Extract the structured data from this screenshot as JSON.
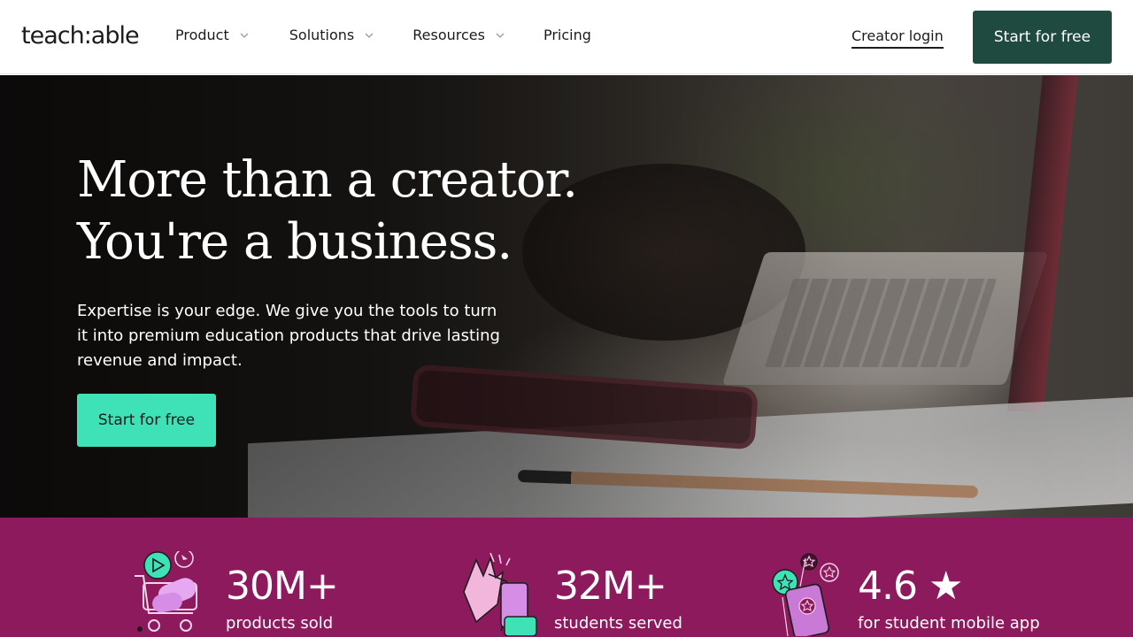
{
  "brand": {
    "logo_text": "teach:able",
    "primary_dark": "#1e4a40",
    "accent_mint": "#3fe2b6",
    "stats_bg": "#8c1a5c"
  },
  "nav": {
    "items": [
      {
        "label": "Product",
        "has_dropdown": true
      },
      {
        "label": "Solutions",
        "has_dropdown": true
      },
      {
        "label": "Resources",
        "has_dropdown": true
      },
      {
        "label": "Pricing",
        "has_dropdown": false
      }
    ],
    "creator_login": "Creator login",
    "cta": "Start for free"
  },
  "hero": {
    "title_line1": "More than a creator.",
    "title_line2": "You're a business.",
    "subtitle": "Expertise is your edge. We give you the tools to turn it into premium education products that drive lasting revenue and impact.",
    "cta": "Start for free"
  },
  "stats": [
    {
      "value": "30M+",
      "label": "products sold",
      "icon": "shopping-cart-icon"
    },
    {
      "value": "32M+",
      "label": "students served",
      "icon": "high-five-icon"
    },
    {
      "value": "4.6 ★",
      "label": "for student mobile app",
      "icon": "phone-stars-icon"
    }
  ]
}
